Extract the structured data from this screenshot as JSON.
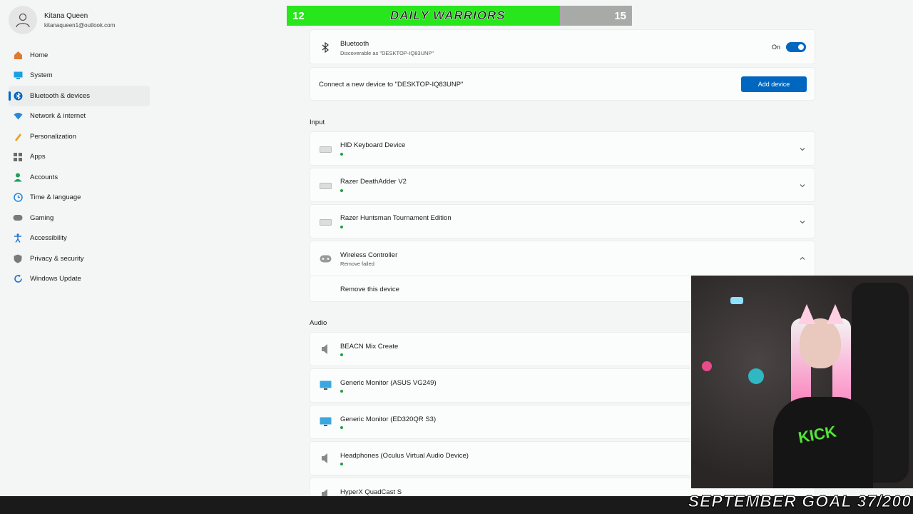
{
  "profile": {
    "name": "Kitana Queen",
    "email": "kitanaqueen1@outlook.com"
  },
  "nav": [
    {
      "label": "Home",
      "icon": "home-icon",
      "color": "#e07a2e"
    },
    {
      "label": "System",
      "icon": "system-icon",
      "color": "#1ba1e2"
    },
    {
      "label": "Bluetooth & devices",
      "icon": "bluetooth-icon",
      "color": "#0067c0",
      "active": true
    },
    {
      "label": "Network & internet",
      "icon": "network-icon",
      "color": "#2b88d8"
    },
    {
      "label": "Personalization",
      "icon": "personalization-icon",
      "color": "#e8a42a"
    },
    {
      "label": "Apps",
      "icon": "apps-icon",
      "color": "#6b6b6b"
    },
    {
      "label": "Accounts",
      "icon": "accounts-icon",
      "color": "#1f9e5a"
    },
    {
      "label": "Time & language",
      "icon": "time-language-icon",
      "color": "#2b88d8"
    },
    {
      "label": "Gaming",
      "icon": "gaming-icon",
      "color": "#7a7a7a"
    },
    {
      "label": "Accessibility",
      "icon": "accessibility-icon",
      "color": "#1f6fd0"
    },
    {
      "label": "Privacy & security",
      "icon": "shield-icon",
      "color": "#7a7a7a"
    },
    {
      "label": "Windows Update",
      "icon": "windows-update-icon",
      "color": "#1f6fd0"
    }
  ],
  "banner": {
    "left": "12",
    "title": "DAILY WARRIORS",
    "right": "15",
    "fill_color": "#27e61b"
  },
  "bluetooth": {
    "title": "Bluetooth",
    "subtitle": "Discoverable as \"DESKTOP-IQ83UNP\"",
    "toggle_label": "On"
  },
  "connect": {
    "text": "Connect a new device to \"DESKTOP-IQ83UNP\"",
    "button": "Add device"
  },
  "input": {
    "label": "Input",
    "devices": [
      {
        "name": "HID Keyboard Device",
        "icon": "keyboard-icon"
      },
      {
        "name": "Razer DeathAdder V2",
        "icon": "keyboard-icon"
      },
      {
        "name": "Razer Huntsman Tournament Edition",
        "icon": "keyboard-icon"
      }
    ],
    "controller": {
      "name": "Wireless Controller",
      "status": "Remove failed",
      "icon": "controller-icon",
      "action": "Remove this device"
    }
  },
  "audio": {
    "label": "Audio",
    "devices": [
      {
        "name": "BEACN Mix Create",
        "icon": "speaker-icon"
      },
      {
        "name": "Generic Monitor (ASUS VG249)",
        "icon": "monitor-icon"
      },
      {
        "name": "Generic Monitor (ED320QR S3)",
        "icon": "monitor-icon"
      },
      {
        "name": "Headphones (Oculus Virtual Audio Device)",
        "icon": "speaker-icon"
      },
      {
        "name": "HyperX QuadCast S",
        "icon": "speaker-icon"
      }
    ]
  },
  "overlay": {
    "shirt_text": "KICK",
    "goal": "SEPTEMBER GOAL 37/200"
  }
}
